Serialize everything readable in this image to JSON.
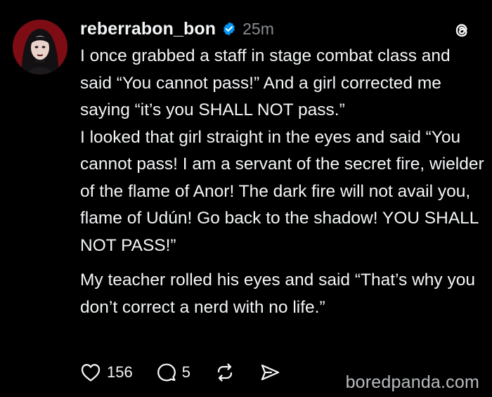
{
  "post": {
    "username": "reberrabon_bon",
    "time": "25m",
    "paragraphs": [
      "I once grabbed a staff in stage combat class and said “You cannot pass!” And a girl corrected me saying “it’s you SHALL NOT pass.”",
      "I looked that girl straight in the eyes and said “You cannot pass! I am a servant of the secret fire, wielder of the flame of Anor! The dark fire will not avail you, flame of Udún! Go back to the shadow! YOU SHALL NOT PASS!”",
      "My teacher rolled his eyes and said “That’s why you don’t correct a nerd with no life.”"
    ],
    "likes": "156",
    "comments": "5"
  },
  "icons": {
    "verified": "verified-badge-icon",
    "app": "threads-logo-icon",
    "like": "heart-icon",
    "comment": "comment-bubble-icon",
    "repost": "repost-icon",
    "share": "send-icon"
  },
  "colors": {
    "background": "#000000",
    "text": "#f3f5f7",
    "muted": "#8a8d91",
    "verified": "#0095f6"
  },
  "watermark": "boredpanda.com"
}
